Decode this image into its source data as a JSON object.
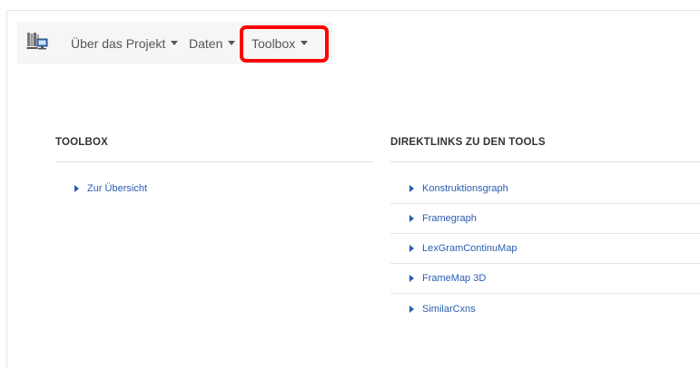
{
  "navbar": {
    "logo_icon": "library-computer-icon",
    "items": [
      {
        "label": "Über das Projekt"
      },
      {
        "label": "Daten"
      },
      {
        "label": "Toolbox"
      }
    ],
    "highlight_color": "#ff0000"
  },
  "toolbox_section": {
    "heading": "TOOLBOX",
    "links": [
      {
        "label": "Zur Übersicht"
      }
    ]
  },
  "direct_links_section": {
    "heading": "DIREKTLINKS ZU DEN TOOLS",
    "links": [
      {
        "label": "Konstruktionsgraph"
      },
      {
        "label": "Framegraph"
      },
      {
        "label": "LexGramContinuMap"
      },
      {
        "label": "FrameMap 3D"
      },
      {
        "label": "SimilarCxns"
      }
    ]
  },
  "colors": {
    "link": "#2a5db0",
    "navbar_bg": "#f6f6f6"
  }
}
